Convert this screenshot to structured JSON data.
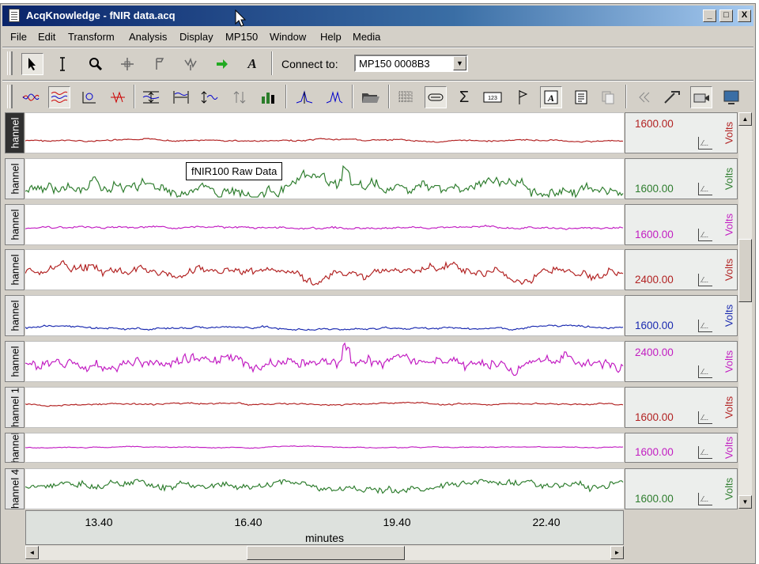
{
  "window": {
    "title": "AcqKnowledge - fNIR data.acq",
    "buttons": {
      "minimize": "_",
      "maximize": "□",
      "close": "X"
    }
  },
  "menu": [
    "File",
    "Edit",
    "Transform",
    "Analysis",
    "Display",
    "MP150",
    "Window",
    "Help",
    "Media"
  ],
  "toolbar1": {
    "connect_label": "Connect to:",
    "connect_value": "MP150 0008B3",
    "icons": [
      "arrow-pointer-icon",
      "i-beam-icon",
      "zoom-icon",
      "crosshair-icon",
      "flag-icon",
      "waveform-tool-icon",
      "green-arrow-icon",
      "font-icon"
    ]
  },
  "toolbar2": {
    "icons": [
      "waveform-overlap-icon",
      "waveform-stack-icon",
      "xy-plot-icon",
      "histogram-icon",
      "autoscale-vertical-icon",
      "autoscale-horizontal-icon",
      "adjust-baseline-icon",
      "overlap-icon",
      "grid-bars-icon",
      "peak-detect-icon",
      "peak-detect-2-icon",
      "open-folder-icon",
      "grid-icon",
      "scale-icon",
      "sigma-icon",
      "measurement-icon",
      "marker-flag-icon",
      "annotation-icon",
      "journal-icon",
      "copy-icon",
      "rewind-icon",
      "tools-icon",
      "camera-icon",
      "monitor-icon"
    ]
  },
  "channels": [
    {
      "label": "hannel",
      "scale": "1600.00",
      "scale_pos": "top",
      "unit": "Volts",
      "color": "#b22222",
      "selected": true
    },
    {
      "label": "hannel",
      "scale": "1600.00",
      "scale_pos": "bottom",
      "unit": "Volts",
      "color": "#2e7d2e"
    },
    {
      "label": "hannel",
      "scale": "1600.00",
      "scale_pos": "bottom",
      "unit": "Volts",
      "color": "#c21dc2"
    },
    {
      "label": "hannel",
      "scale": "2400.00",
      "scale_pos": "bottom",
      "unit": "Volts",
      "color": "#b22222"
    },
    {
      "label": "hannel",
      "scale": "1600.00",
      "scale_pos": "bottom",
      "unit": "Volts",
      "color": "#1a2ab0"
    },
    {
      "label": "hannel",
      "scale": "2400.00",
      "scale_pos": "top",
      "unit": "Volts",
      "color": "#c21dc2"
    },
    {
      "label": "hannel 1",
      "scale": "1600.00",
      "scale_pos": "bottom",
      "unit": "Volts",
      "color": "#b22222"
    },
    {
      "label": "hannel",
      "scale": "1600.00",
      "scale_pos": "bottom",
      "unit": "Volts",
      "color": "#c21dc2"
    },
    {
      "label": "hannel 4",
      "scale": "1600.00",
      "scale_pos": "bottom",
      "unit": "Volts",
      "color": "#2e7d2e"
    }
  ],
  "tooltip": "fNIR100 Raw Data",
  "time_axis": {
    "ticks": [
      "13.40",
      "16.40",
      "19.40",
      "22.40"
    ],
    "title": "minutes"
  },
  "scroll_arrows": {
    "up": "▲",
    "down": "▼",
    "left": "◄",
    "right": "►"
  }
}
